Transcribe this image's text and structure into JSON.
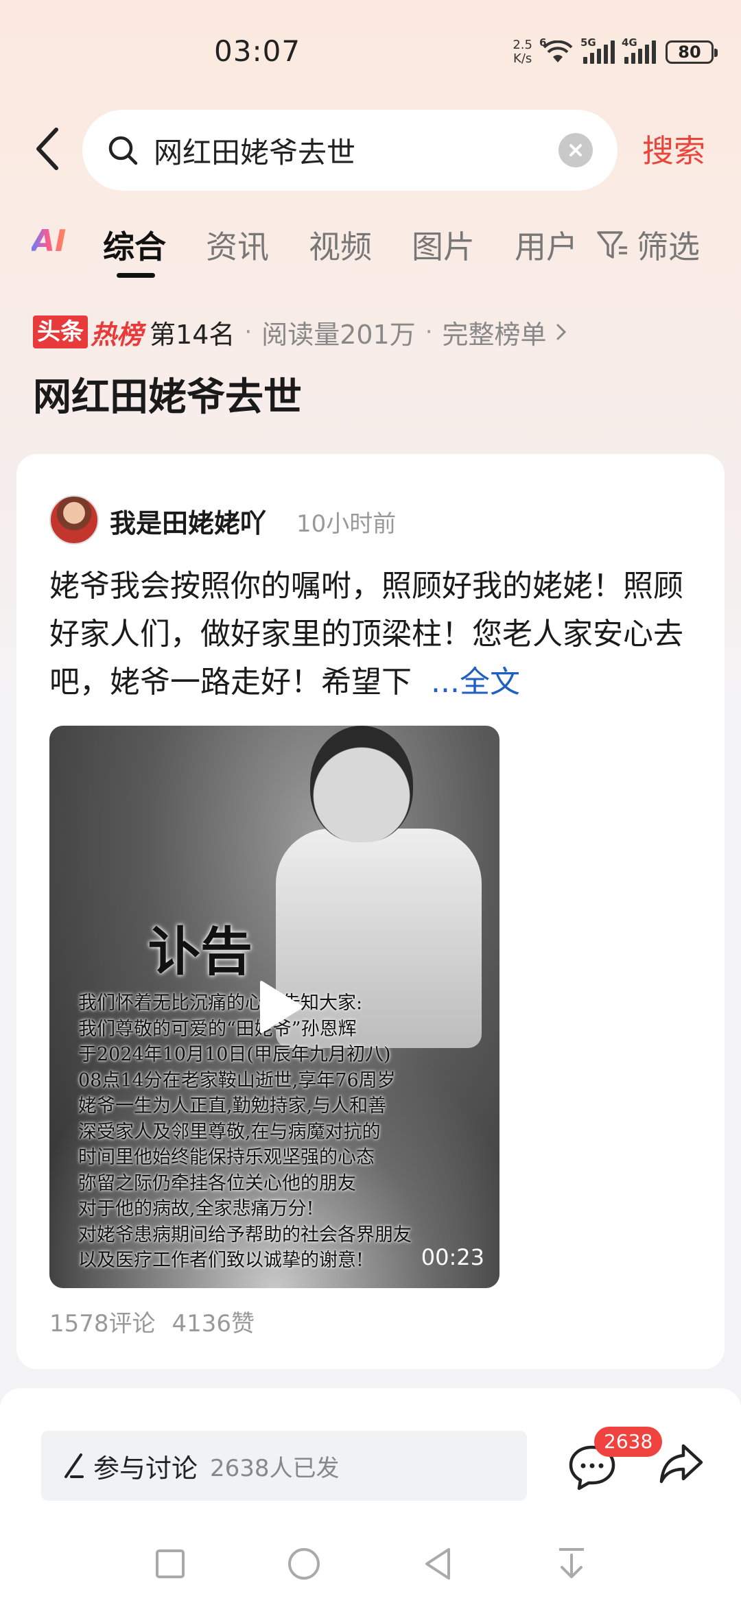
{
  "status_bar": {
    "time": "03:07",
    "net_speed_value": "2.5",
    "net_speed_unit": "K/s",
    "wifi_label": "6",
    "sim1_label": "5G",
    "sim2_label": "4G",
    "battery": "80"
  },
  "search": {
    "query": "网红田姥爷去世",
    "submit_label": "搜索"
  },
  "tabs": {
    "ai_label": "AI",
    "items": [
      "综合",
      "资讯",
      "视频",
      "图片",
      "用户"
    ],
    "active": "综合",
    "filter_label": "筛选"
  },
  "hot": {
    "logo_box": "头条",
    "logo_text": "热榜",
    "rank": "第14名",
    "reads": "阅读量201万",
    "full_list": "完整榜单",
    "topic_title": "网红田姥爷去世"
  },
  "post": {
    "author": "我是田姥姥吖",
    "time": "10小时前",
    "text": "姥爷我会按照你的嘱咐，照顾好我的姥姥！照顾好家人们，做好家里的顶梁柱！您老人家安心去吧，姥爷一路走好！希望下",
    "full_text_link": "...全文",
    "video": {
      "title": "讣告",
      "lines": [
        "我们怀着无比沉痛的心情告知大家:",
        "我们尊敬的可爱的“田姥爷”孙恩辉",
        "于2024年10月10日(甲辰年九月初八)",
        "08点14分在老家鞍山逝世,享年76周岁",
        "姥爷一生为人正直,勤勉持家,与人和善",
        "深受家人及邻里尊敬,在与病魔对抗的",
        "时间里他始终能保持乐观坚强的心态",
        "弥留之际仍牵挂各位关心他的朋友",
        "对于他的病故,全家悲痛万分!",
        "对姥爷患病期间给予帮助的社会各界朋友",
        "以及医疗工作者们致以诚挚的谢意!"
      ],
      "duration": "00:23"
    },
    "comments": "1578评论",
    "likes": "4136赞"
  },
  "bottom": {
    "discuss_label": "参与讨论",
    "discuss_count": "2638人已发",
    "comment_badge": "2638"
  },
  "colors": {
    "accent_red": "#e8453c",
    "link_blue": "#1e5fbf"
  }
}
